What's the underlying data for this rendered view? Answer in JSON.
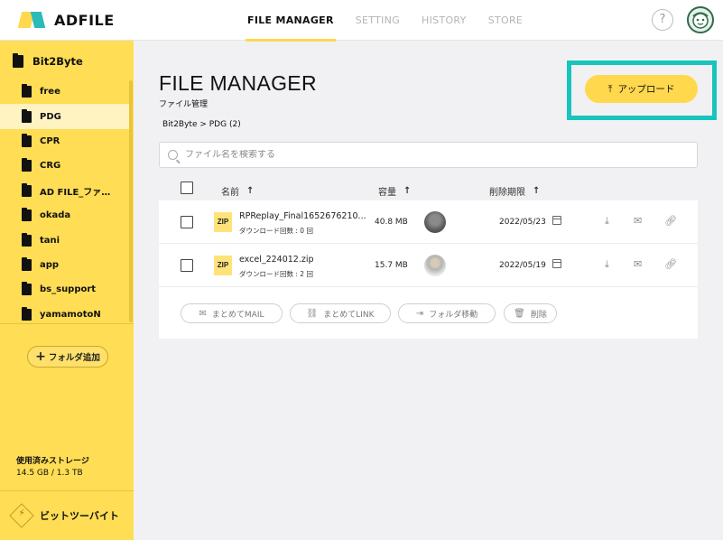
{
  "header": {
    "logo_text": "ADFILE",
    "tabs": [
      {
        "label": "FILE MANAGER",
        "active": true
      },
      {
        "label": "SETTING",
        "active": false
      },
      {
        "label": "HISTORY",
        "active": false
      },
      {
        "label": "STORE",
        "active": false
      }
    ],
    "help_label": "?",
    "accent_color": "#ffd84d",
    "brand_teal": "#2bbbb8"
  },
  "sidebar": {
    "root_label": "Bit2Byte",
    "items": [
      {
        "label": "free",
        "active": false
      },
      {
        "label": "PDG",
        "active": true
      },
      {
        "label": "CPR",
        "active": false
      },
      {
        "label": "CRG",
        "active": false
      },
      {
        "label": "AD FILE_ファ…",
        "active": false
      },
      {
        "label": "okada",
        "active": false
      },
      {
        "label": "tani",
        "active": false
      },
      {
        "label": "app",
        "active": false
      },
      {
        "label": "bs_support",
        "active": false
      },
      {
        "label": "yamamotoN",
        "active": false
      }
    ],
    "add_folder_label": "フォルダ追加",
    "storage_label": "使用済みストレージ",
    "storage_value": "14.5 GB / 1.3 TB",
    "company_label": "ビットツーバイト",
    "background_color": "#ffdd55"
  },
  "main": {
    "title": "FILE MANAGER",
    "subtitle": "ファイル管理",
    "breadcrumb": "Bit2Byte > PDG (2)",
    "upload_label": "アップロード",
    "highlight_color": "#17c5bc",
    "search_placeholder": "ファイル名を検索する",
    "columns": {
      "name": "名前",
      "size": "容量",
      "expiry": "削除期限"
    },
    "files": [
      {
        "type_badge": "ZIP",
        "name": "RPReplay_Final1652676210...",
        "downloads": "ダウンロード回数 : 0 回",
        "size": "40.8 MB",
        "expiry": "2022/05/23"
      },
      {
        "type_badge": "ZIP",
        "name": "excel_224012.zip",
        "downloads": "ダウンロード回数 : 2 回",
        "size": "15.7 MB",
        "expiry": "2022/05/19"
      }
    ],
    "bulk_actions": {
      "mail": "まとめてMAIL",
      "link": "まとめてLINK",
      "move": "フォルダ移動",
      "delete": "削除"
    }
  }
}
